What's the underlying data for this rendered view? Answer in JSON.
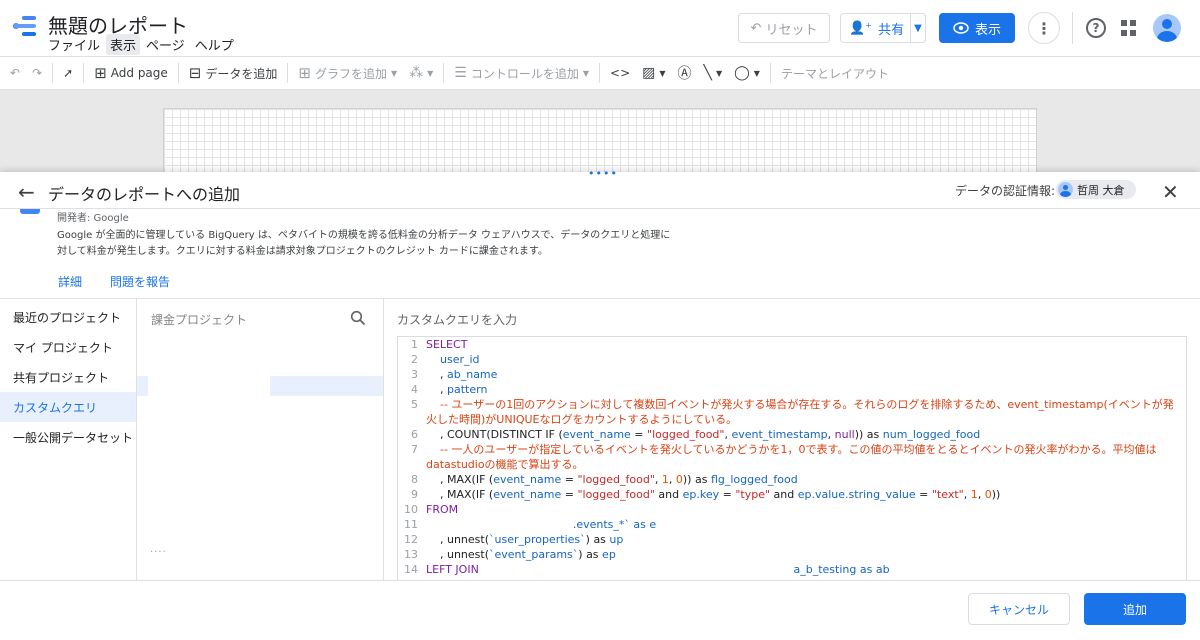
{
  "app": {
    "title": "無題のレポート",
    "menu": [
      "ファイル",
      "表示",
      "ページ",
      "ヘルプ"
    ],
    "active_menu_index": 1
  },
  "header_actions": {
    "reset_label": "リセット",
    "share_label": "共有",
    "view_label": "表示"
  },
  "toolbar": {
    "add_page_label": "Add page",
    "add_data_label": "データを追加",
    "add_chart_label": "グラフを追加",
    "add_control_label": "コントロールを追加",
    "theme_label": "テーマとレイアウト"
  },
  "panel": {
    "title": "データのレポートへの追加",
    "credentials_label": "データの認証情報:",
    "credentials_user": "哲周 大倉",
    "publisher": "開発者: Google",
    "description": "Google が全面的に管理している BigQuery は、ペタバイトの規模を誇る低料金の分析データ ウェアハウスで、データのクエリと処理に対して料金が発生します。クエリに対する料金は請求対象プロジェクトのクレジット カードに課金されます。",
    "details_link": "詳細",
    "report_link": "問題を報告"
  },
  "nav": {
    "items": [
      "最近のプロジェクト",
      "マイ プロジェクト",
      "共有プロジェクト",
      "カスタムクエリ",
      "一般公開データセット"
    ],
    "selected_index": 3
  },
  "billing": {
    "label": "課金プロジェクト",
    "dots": "...."
  },
  "query": {
    "label": "カスタムクエリを入力",
    "line_numbers": [
      "1",
      "2",
      "3",
      "4",
      "5",
      "6",
      "7",
      "8",
      "9",
      "10",
      "11",
      "12",
      "13",
      "14"
    ],
    "lines": [
      [
        {
          "t": "SELECT",
          "c": "kw"
        }
      ],
      [
        {
          "t": "    user_id",
          "c": "id"
        }
      ],
      [
        {
          "t": "    , ",
          "c": "op"
        },
        {
          "t": "ab_name",
          "c": "id"
        }
      ],
      [
        {
          "t": "    , ",
          "c": "op"
        },
        {
          "t": "pattern",
          "c": "id"
        }
      ],
      [
        {
          "t": "    -- ユーザーの1回のアクションに対して複数回イベントが発火する場合が存在する。それらのログを排除するため、event_timestamp(イベントが発火した時間)がUNIQUEなログをカウントするようにしている。",
          "c": "cmt"
        }
      ],
      [
        {
          "t": "    , COUNT(DISTINCT IF (",
          "c": "op"
        },
        {
          "t": "event_name",
          "c": "id"
        },
        {
          "t": " = ",
          "c": "op"
        },
        {
          "t": "\"logged_food\"",
          "c": "str"
        },
        {
          "t": ", ",
          "c": "op"
        },
        {
          "t": "event_timestamp",
          "c": "id"
        },
        {
          "t": ", ",
          "c": "op"
        },
        {
          "t": "null",
          "c": "kw"
        },
        {
          "t": ")) as ",
          "c": "op"
        },
        {
          "t": "num_logged_food",
          "c": "id"
        }
      ],
      [
        {
          "t": "    -- 一人のユーザーが指定しているイベントを発火しているかどうかを1，0で表す。この値の平均値をとるとイベントの発火率がわかる。平均値はdatastudioの機能で算出する。",
          "c": "cmt"
        }
      ],
      [
        {
          "t": "    , MAX(IF (",
          "c": "op"
        },
        {
          "t": "event_name",
          "c": "id"
        },
        {
          "t": " = ",
          "c": "op"
        },
        {
          "t": "\"logged_food\"",
          "c": "str"
        },
        {
          "t": ", ",
          "c": "op"
        },
        {
          "t": "1",
          "c": "num"
        },
        {
          "t": ", ",
          "c": "op"
        },
        {
          "t": "0",
          "c": "num"
        },
        {
          "t": ")) as ",
          "c": "op"
        },
        {
          "t": "flg_logged_food",
          "c": "id"
        }
      ],
      [
        {
          "t": "    , MAX(IF (",
          "c": "op"
        },
        {
          "t": "event_name",
          "c": "id"
        },
        {
          "t": " = ",
          "c": "op"
        },
        {
          "t": "\"logged_food\"",
          "c": "str"
        },
        {
          "t": " and ",
          "c": "op"
        },
        {
          "t": "ep.key",
          "c": "id"
        },
        {
          "t": " = ",
          "c": "op"
        },
        {
          "t": "\"type\"",
          "c": "str"
        },
        {
          "t": " and ",
          "c": "op"
        },
        {
          "t": "ep.value.string_value",
          "c": "id"
        },
        {
          "t": " = ",
          "c": "op"
        },
        {
          "t": "\"text\"",
          "c": "str"
        },
        {
          "t": ", ",
          "c": "op"
        },
        {
          "t": "1",
          "c": "num"
        },
        {
          "t": ", ",
          "c": "op"
        },
        {
          "t": "0",
          "c": "num"
        },
        {
          "t": "))",
          "c": "op"
        }
      ],
      [
        {
          "t": "FROM",
          "c": "kw"
        }
      ],
      [
        {
          "t": "                                          .events_*` as ",
          "c": "id"
        },
        {
          "t": "e",
          "c": "id"
        }
      ],
      [
        {
          "t": "    , unnest(",
          "c": "op"
        },
        {
          "t": "`user_properties`",
          "c": "id"
        },
        {
          "t": ") as ",
          "c": "op"
        },
        {
          "t": "up",
          "c": "id"
        }
      ],
      [
        {
          "t": "    , unnest(",
          "c": "op"
        },
        {
          "t": "`event_params`",
          "c": "id"
        },
        {
          "t": ") as ",
          "c": "op"
        },
        {
          "t": "ep",
          "c": "id"
        }
      ],
      [
        {
          "t": "LEFT JOIN",
          "c": "kw"
        },
        {
          "t": "                                                                                          a_b_testing as ab",
          "c": "id"
        }
      ]
    ]
  },
  "footer": {
    "cancel_label": "キャンセル",
    "add_label": "追加"
  },
  "colors": {
    "accent": "#1a73e8",
    "selected_bg": "#e8f0fe"
  }
}
